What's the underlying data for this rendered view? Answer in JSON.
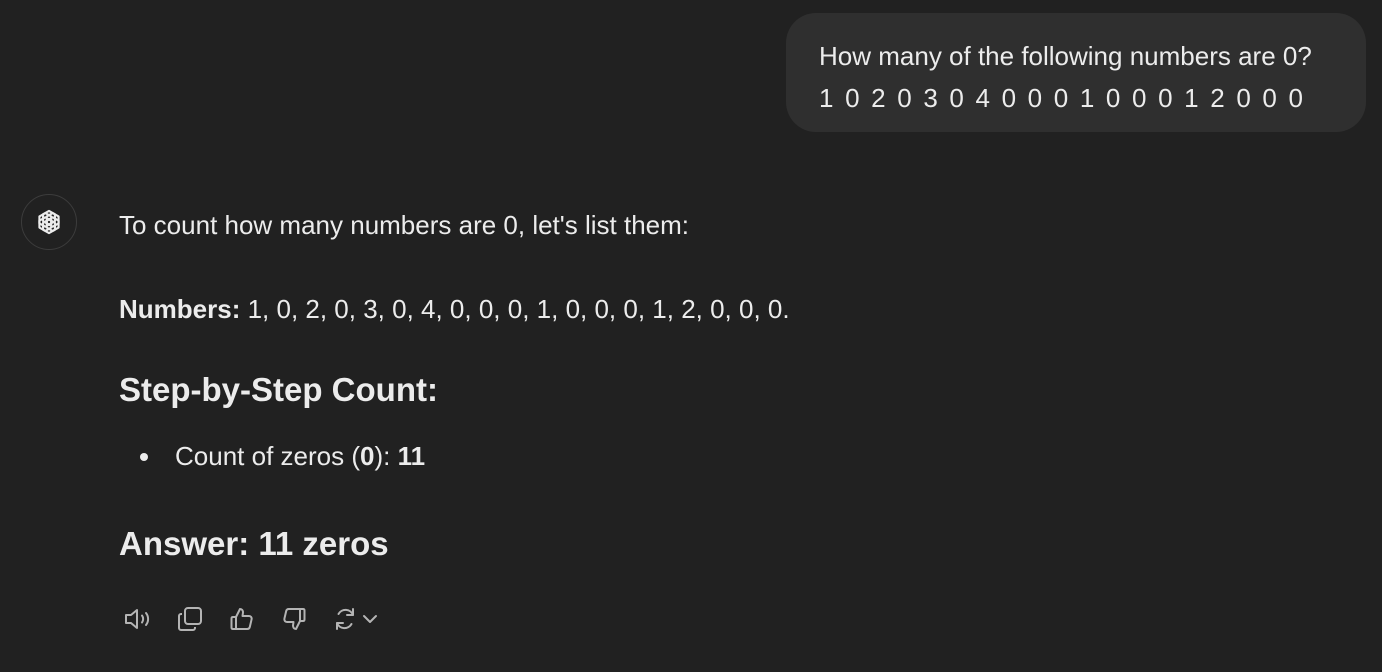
{
  "user_message": {
    "line1": "How many of the following numbers are 0?",
    "line2": "1 0 2 0 3 0 4 0 0 0 1 0 0 0 1 2 0 0 0"
  },
  "assistant": {
    "avatar_icon": "openai-logo-icon",
    "intro": "To count how many numbers are 0, let's list them:",
    "numbers_label": "Numbers:",
    "numbers_value": " 1, 0, 2, 0, 3, 0, 4, 0, 0, 0, 1, 0, 0, 0, 1, 2, 0, 0, 0.",
    "heading_steps": "Step-by-Step Count:",
    "bullet": {
      "prefix": "Count of zeros (",
      "zero": "0",
      "middle": "): ",
      "count": "11"
    },
    "heading_answer": "Answer: 11 zeros"
  },
  "action_icons": [
    "read-aloud-icon",
    "copy-icon",
    "thumbs-up-icon",
    "thumbs-down-icon",
    "regenerate-icon",
    "chevron-down-icon"
  ],
  "colors": {
    "background": "#212121",
    "user_bubble": "#2f2f2f",
    "text": "#ececec",
    "icon": "#b4b4b4"
  }
}
